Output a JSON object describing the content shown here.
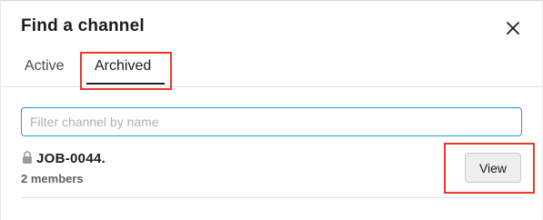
{
  "dialog": {
    "title": "Find a channel",
    "close_icon": "close-icon"
  },
  "tabs": [
    {
      "label": "Active",
      "selected": false
    },
    {
      "label": "Archived",
      "selected": true
    }
  ],
  "filter": {
    "placeholder": "Filter channel by name",
    "value": ""
  },
  "channels": [
    {
      "name": "JOB-0044.",
      "members": "2 members",
      "icon": "lock-icon",
      "action_label": "View"
    }
  ],
  "colors": {
    "highlight": "#e8392b",
    "input_focus": "#1d9bd1",
    "text_primary": "#1d1c1d",
    "text_secondary": "#616061"
  }
}
